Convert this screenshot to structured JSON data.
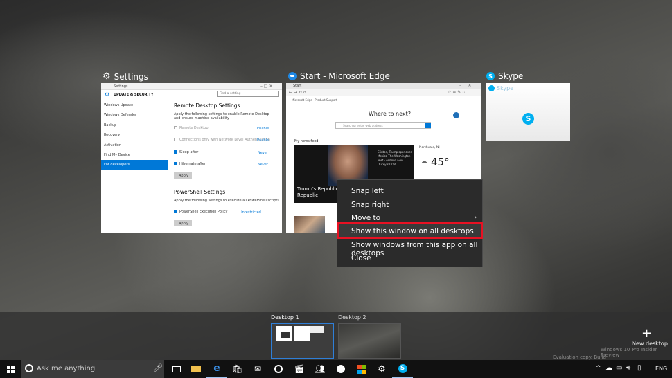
{
  "windows": [
    {
      "title": "Settings"
    },
    {
      "title": "Start - Microsoft Edge"
    },
    {
      "title": "Skype"
    }
  ],
  "settings": {
    "header": "Settings",
    "section": "UPDATE & SECURITY",
    "search_placeholder": "Find a setting",
    "nav": [
      "Windows Update",
      "Windows Defender",
      "Backup",
      "Recovery",
      "Activation",
      "Find My Device",
      "For developers"
    ],
    "remote_title": "Remote Desktop Settings",
    "remote_desc": "Apply the following settings to enable Remote Desktop and ensure machine availability",
    "rows": [
      {
        "label": "Remote Desktop",
        "link": "Enable"
      },
      {
        "label": "Connections only with Network Level Authentication",
        "link": "Enable"
      },
      {
        "label": "Sleep after",
        "link": "Never"
      },
      {
        "label": "Hibernate after",
        "link": "Never"
      }
    ],
    "apply": "Apply",
    "ps_title": "PowerShell Settings",
    "ps_desc": "Apply the following settings to execute all PowerShell scripts",
    "ps_row": "PowerShell Execution Policy",
    "ps_link": "Unrestricted"
  },
  "edge": {
    "tab": "Start",
    "favs": "Microsoft Edge · Product Support",
    "heading": "Where to next?",
    "search_placeholder": "Search or enter web address",
    "news_feed": "My news feed",
    "weather_loc": "Northvale, NJ",
    "temp": "45°",
    "headline": "Trump's Republican Bewilder Republic",
    "sidebar_news": "Clinton, Trump spar over Mexico The Washington Post · Arizona Gov. Ducey's GOP ..."
  },
  "skype": {
    "title": "Skype"
  },
  "context_menu": [
    "Snap left",
    "Snap right",
    "Move to",
    "Show this window on all desktops",
    "Show windows from this app on all desktops",
    "Close"
  ],
  "desktops": [
    {
      "label": "Desktop 1"
    },
    {
      "label": "Desktop 2"
    }
  ],
  "new_desktop": "New desktop",
  "watermark": {
    "line1": "Windows 10 Pro Insider Preview",
    "line2": "Evaluation copy. Build 14316.rs1_release.160402-2217"
  },
  "taskbar": {
    "search_placeholder": "Ask me anything",
    "lang": "ENG"
  },
  "colors": {
    "highlight": "#e81123",
    "accent": "#0078d7",
    "skype": "#00aff0"
  }
}
